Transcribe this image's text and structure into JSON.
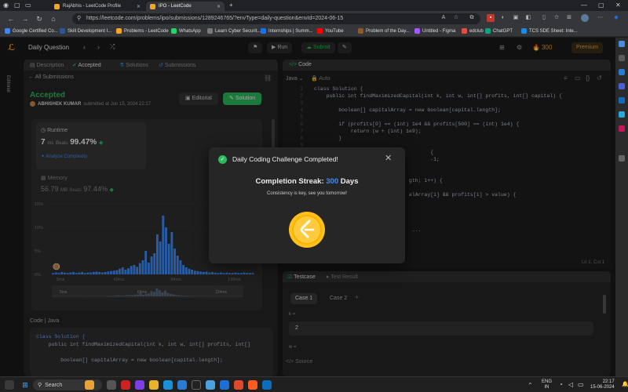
{
  "browser": {
    "tabs": [
      {
        "title": "RajAbhis - LeetCode Profile"
      },
      {
        "title": "IPO - LeetCode"
      }
    ],
    "url": "https://leetcode.com/problems/ipo/submissions/1289246765/?envType=daily-question&envId=2024-06-15",
    "bookmarks": [
      {
        "label": "Google Certified Co...",
        "color": "#4285f4"
      },
      {
        "label": "Skill Development I...",
        "color": "#2b579a"
      },
      {
        "label": "Problems - LeetCode",
        "color": "#f5a623"
      },
      {
        "label": "WhatsApp",
        "color": "#25d366"
      },
      {
        "label": "Learn Cyber Securit...",
        "color": "#7a7a7a"
      },
      {
        "label": "Internships | Summ...",
        "color": "#1a73e8"
      },
      {
        "label": "YouTube",
        "color": "#ff0000"
      },
      {
        "label": "Problem of the Day...",
        "color": "#8a5a2b"
      },
      {
        "label": "Untitled - Figma",
        "color": "#a259ff"
      },
      {
        "label": "edclub",
        "color": "#e74c3c"
      },
      {
        "label": "ChatGPT",
        "color": "#10a37f"
      },
      {
        "label": "TCS SDE Sheet: Inte...",
        "color": "#1e88e5"
      }
    ]
  },
  "header": {
    "problem_list": "Daily Question",
    "run_label": "Run",
    "submit_label": "Submit",
    "streak": "300",
    "premium_label": "Premium"
  },
  "left": {
    "vertical_tab": "Editorial",
    "tabs": [
      {
        "label": "Description"
      },
      {
        "label": "Accepted"
      },
      {
        "label": "Solutions"
      },
      {
        "label": "Submissions"
      }
    ],
    "all_submissions": "All Submissions",
    "status": "Accepted",
    "author": "ABHISHEK KUMAR",
    "submitted_text": "submitted at Jun 15, 2024 22:17",
    "editorial_btn": "Editorial",
    "solution_btn": "Solution",
    "runtime_label": "Runtime",
    "runtime_value": "7",
    "runtime_unit": "ms",
    "runtime_beats_label": "Beats",
    "runtime_beats": "99.47%",
    "analyze_label": "Analyze Complexity",
    "memory_label": "Memory",
    "memory_value": "56.79",
    "memory_unit": "MB",
    "memory_beats_label": "Beats",
    "memory_beats": "97.44%",
    "code_header": "Code",
    "code_lang": "Java",
    "code_lines": [
      "class Solution {",
      "    public int findMaximizedCapital(int k, int w, int[] profits, int[]",
      "",
      "        boolean[] capitalArray = new boolean[capital.length];"
    ]
  },
  "chart_data": {
    "type": "bar",
    "ylabels": [
      "15%",
      "10%",
      "5%",
      "0%"
    ],
    "xlabels": [
      "5ms",
      "49ms",
      "94ms",
      "139ms"
    ],
    "range_labels": [
      "5ms",
      "64ms",
      "124ms"
    ],
    "values": [
      0.3,
      0.4,
      0.3,
      0.5,
      0.4,
      0.3,
      0.4,
      0.5,
      0.3,
      0.4,
      0.5,
      0.3,
      0.4,
      0.4,
      0.5,
      0.6,
      0.5,
      0.4,
      0.5,
      0.6,
      0.7,
      0.8,
      0.9,
      1.2,
      1.5,
      1.0,
      1.3,
      1.8,
      2.0,
      1.6,
      2.4,
      3.0,
      5.0,
      2.5,
      3.8,
      4.5,
      8.5,
      7.0,
      12.5,
      10.0,
      6.5,
      9.0,
      5.5,
      4.0,
      3.0,
      2.0,
      1.5,
      1.2,
      1.0,
      0.8,
      0.7,
      0.6,
      0.5,
      0.6,
      0.4,
      0.5,
      0.4,
      0.3,
      0.4,
      0.3,
      0.4,
      0.3,
      0.3,
      0.4,
      0.3,
      0.3,
      0.4,
      0.3,
      0.3,
      0.3
    ],
    "highlight_index": 0,
    "ylim": [
      0,
      15
    ]
  },
  "editor": {
    "title": "Code",
    "language": "Java",
    "auto_label": "Auto",
    "cursor": "Ln 1, Col 1",
    "lines": [
      "class Solution {",
      "    public int findMaximizedCapital(int k, int w, int[] profits, int[] capital) {",
      "",
      "        boolean[] capitalArray = new boolean[capital.length];",
      "",
      "        if (profits[0] == (int) 1e4 && profits[500] == (int) 1e4) {",
      "            return (w + (int) 1e9);",
      "        }",
      "",
      "                                      {",
      "                                      -1;",
      "",
      "",
      "                               gth; i++) {",
      "",
      "                               alArray[i] && profits[i] > value) {",
      "",
      "",
      "",
      "",
      "                                ..."
    ]
  },
  "testcase": {
    "tab_label": "Testcase",
    "result_label": "Test Result",
    "cases": [
      {
        "label": "Case 1"
      },
      {
        "label": "Case 2"
      }
    ],
    "add_label": "+",
    "k_label": "k =",
    "k_value": "2",
    "w_label": "w =",
    "source_label": "Source"
  },
  "modal": {
    "title": "Daily Coding Challenge Completed!",
    "streak_label": "Completion Streak:",
    "streak_value": "300",
    "streak_unit": "Days",
    "subtitle": "Consistency is key, see you tomorrow!"
  },
  "taskbar": {
    "search_placeholder": "Search",
    "lang_line1": "ENG",
    "lang_line2": "IN",
    "time": "22:17",
    "date": "15-06-2024"
  },
  "colors": {
    "accent_green": "#2cbb5d",
    "streak_blue": "#3e8eff",
    "coin_yellow": "#ffc01e",
    "premium_orange": "#ffa116"
  }
}
